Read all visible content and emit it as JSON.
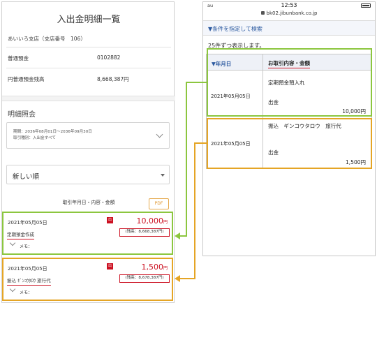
{
  "left": {
    "title": "入出金明細一覧",
    "branch": "あいいろ支店（支店番号　106）",
    "account_type_label": "普通預金",
    "account_number": "0102882",
    "balance_label": "円普通預金残高",
    "balance_value": "8,668,387円",
    "section_title": "明細照会",
    "period_line1": "期間：2036年08月01日～2036年09月30日",
    "period_line2": "取引種別：入出金すべて",
    "sort_selected": "新しい順",
    "list_header": "取引年月日・内容・金額",
    "pdf_label": "PDF",
    "transactions": [
      {
        "date": "2021年05月05日",
        "badge": "出",
        "amount": "10,000",
        "yen": "円",
        "description": "定期預金作成",
        "balance": "(残高：8,668,387円)",
        "memo": "メモ："
      },
      {
        "date": "2021年05月05日",
        "badge": "出",
        "amount": "1,500",
        "yen": "円",
        "description": "振込 ｷﾞﾝｺｳﾀﾛｳ 旅行代",
        "balance": "(残高：8,678,387円)",
        "memo": "メモ："
      }
    ]
  },
  "phone": {
    "carrier": "au",
    "time": "12:53",
    "url": "bk02.jibunbank.co.jp",
    "filter_label": "▼条件を指定して検索",
    "count_text": "25件ずつ表示します。",
    "col_date": "▼年月日",
    "col_content": "お取引内容・金額",
    "rows": [
      {
        "date": "2021年05月05日",
        "line1": "定期預金預入れ",
        "type": "出金",
        "amount": "10,000円"
      },
      {
        "date": "2021年05月05日",
        "line1": "振込　ギンコウタロウ　旅行代",
        "type": "出金",
        "amount": "1,500円"
      }
    ]
  },
  "colors": {
    "green_highlight": "#8cc63f",
    "orange_highlight": "#e5a525",
    "red": "#cc1122",
    "link_blue": "#2c5aa0"
  }
}
